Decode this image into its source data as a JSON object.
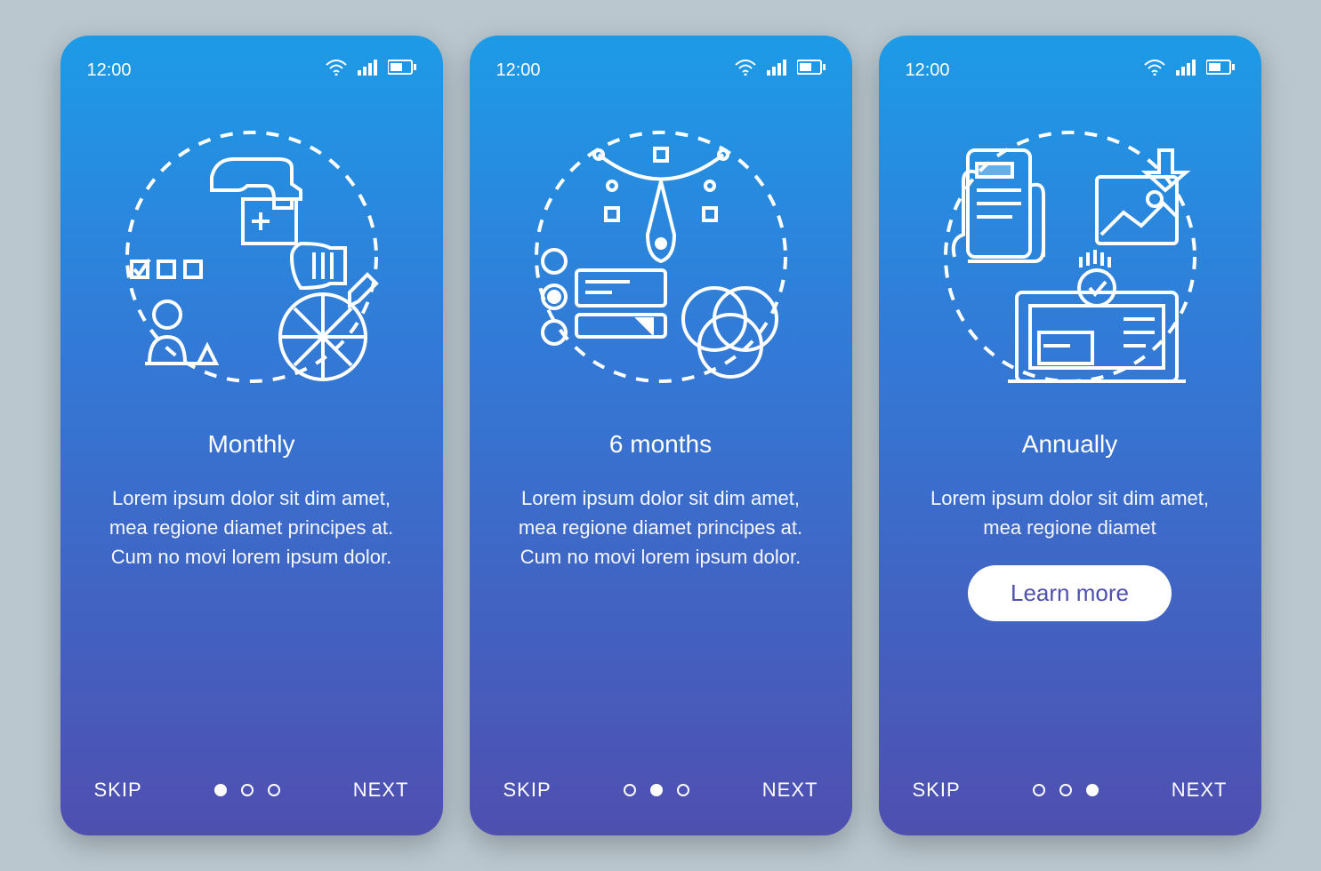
{
  "status": {
    "time": "12:00",
    "wifi_icon": "wifi-icon",
    "signal_icon": "signal-icon",
    "battery_icon": "battery-icon"
  },
  "screens": [
    {
      "title": "Monthly",
      "description": "Lorem ipsum dolor sit dim amet, mea regione diamet principes at. Cum no movi lorem ipsum dolor.",
      "skip": "SKIP",
      "next": "NEXT",
      "active_dot": 0,
      "has_cta": false
    },
    {
      "title": "6 months",
      "description": "Lorem ipsum dolor sit dim amet, mea regione diamet principes at. Cum no movi lorem ipsum dolor.",
      "skip": "SKIP",
      "next": "NEXT",
      "active_dot": 1,
      "has_cta": false
    },
    {
      "title": "Annually",
      "description": "Lorem ipsum dolor sit dim amet, mea regione diamet",
      "skip": "SKIP",
      "next": "NEXT",
      "active_dot": 2,
      "has_cta": true,
      "cta_label": "Learn more"
    }
  ]
}
